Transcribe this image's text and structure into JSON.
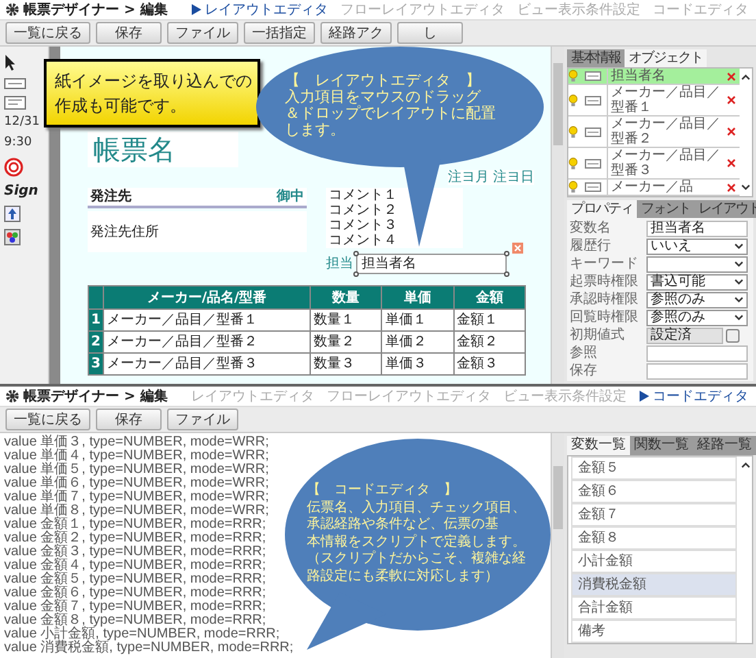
{
  "top": {
    "header": {
      "title": "帳票デザイナー > 編集",
      "tabs": [
        {
          "label": "レイアウトエディタ",
          "selected": true
        },
        {
          "label": "フローレイアウトエディタ",
          "selected": false
        },
        {
          "label": "ビュー表示条件設定",
          "selected": false
        },
        {
          "label": "コードエディタ",
          "selected": false
        }
      ]
    },
    "toolbar": [
      "一覧に戻る",
      "保存",
      "ファイル",
      "一括指定",
      "経路アク",
      "し"
    ],
    "palette": {
      "date": "12/31",
      "time": "9:30",
      "sign": "Sign"
    },
    "note": [
      "紙イメージを取り込んでの",
      "作成も可能です。"
    ],
    "callout": [
      "【　レイアウトエディタ　】",
      "入力項目をマウスのドラッグ",
      "＆ドロップでレイアウトに配置",
      "します。"
    ],
    "form": {
      "title": "帳票名",
      "date": "注ヨ月 注ヨ日",
      "recipient": "発注先",
      "honorific": "御中",
      "address": "発注先住所",
      "comments": [
        "コメント１",
        "コメント２",
        "コメント３",
        "コメント４"
      ],
      "staff_label": "担当",
      "staff_field": "担当者名",
      "table": {
        "columns": [
          "メーカー/品名/型番",
          "数量",
          "単価",
          "金額"
        ],
        "rows": [
          {
            "no": "1",
            "cells": [
              "メーカー／品目／型番１",
              "数量１",
              "単価１",
              "金額１"
            ]
          },
          {
            "no": "2",
            "cells": [
              "メーカー／品目／型番２",
              "数量２",
              "単価２",
              "金額２"
            ]
          },
          {
            "no": "3",
            "cells": [
              "メーカー／品目／型番３",
              "数量３",
              "単価３",
              "金額３"
            ]
          }
        ]
      }
    },
    "side": {
      "tabs": [
        {
          "label": "基本情報",
          "selected": false
        },
        {
          "label": "オブジェクト",
          "selected": true
        }
      ],
      "objects": [
        {
          "name": "担当者名",
          "selected": true
        },
        {
          "name": "メーカー／品目／型番１",
          "selected": false
        },
        {
          "name": "メーカー／品目／型番２",
          "selected": false
        },
        {
          "name": "メーカー／品目／型番３",
          "selected": false
        },
        {
          "name": "メーカー／品",
          "selected": false
        }
      ],
      "prop_tabs": [
        {
          "label": "プロパティ",
          "selected": true
        },
        {
          "label": "フォント",
          "selected": false
        },
        {
          "label": "レイアウト",
          "selected": false
        }
      ],
      "props": [
        {
          "label": "変数名",
          "kind": "text",
          "value": "担当者名"
        },
        {
          "label": "履歴行",
          "kind": "select",
          "value": "いいえ"
        },
        {
          "label": "キーワード",
          "kind": "select"
        },
        {
          "label": "起票時権限",
          "kind": "select",
          "value": "書込可能"
        },
        {
          "label": "承認時権限",
          "kind": "select",
          "value": "参照のみ"
        },
        {
          "label": "回覧時権限",
          "kind": "select",
          "value": "参照のみ"
        },
        {
          "label": "初期値式",
          "kind": "readonly",
          "value": "設定済"
        },
        {
          "label": "参照",
          "kind": "text"
        },
        {
          "label": "保存",
          "kind": "text"
        }
      ]
    }
  },
  "bottom": {
    "header": {
      "title": "帳票デザイナー > 編集",
      "tabs": [
        {
          "label": "レイアウトエディタ",
          "selected": false
        },
        {
          "label": "フローレイアウトエディタ",
          "selected": false
        },
        {
          "label": "ビュー表示条件設定",
          "selected": false
        },
        {
          "label": "コードエディタ",
          "selected": true
        }
      ]
    },
    "toolbar": [
      "一覧に戻る",
      "保存",
      "ファイル"
    ],
    "code": [
      "value 単価３, type=NUMBER, mode=WRR;",
      "value 単価４, type=NUMBER, mode=WRR;",
      "value 単価５, type=NUMBER, mode=WRR;",
      "value 単価６, type=NUMBER, mode=WRR;",
      "value 単価７, type=NUMBER, mode=WRR;",
      "value 単価８, type=NUMBER, mode=WRR;",
      "value 金額１, type=NUMBER, mode=RRR;",
      "value 金額２, type=NUMBER, mode=RRR;",
      "value 金額３, type=NUMBER, mode=RRR;",
      "value 金額４, type=NUMBER, mode=RRR;",
      "value 金額５, type=NUMBER, mode=RRR;",
      "value 金額６, type=NUMBER, mode=RRR;",
      "value 金額７, type=NUMBER, mode=RRR;",
      "value 金額８, type=NUMBER, mode=RRR;",
      "value 小計金額, type=NUMBER, mode=RRR;",
      "value 消費税金額, type=NUMBER, mode=RRR;"
    ],
    "callout": [
      "【　コードエディタ　】",
      "伝票名、入力項目、チェック項目、",
      "承認経路や条件など、伝票の基",
      "本情報をスクリプトで定義します。",
      "（スクリプトだからこそ、複雑な経",
      "路設定にも柔軟に対応します）"
    ],
    "side": {
      "tabs": [
        {
          "label": "変数一覧",
          "selected": true
        },
        {
          "label": "関数一覧",
          "selected": false
        },
        {
          "label": "経路一覧",
          "selected": false
        }
      ],
      "vars": [
        {
          "name": "金額５",
          "selected": false
        },
        {
          "name": "金額６",
          "selected": false
        },
        {
          "name": "金額７",
          "selected": false
        },
        {
          "name": "金額８",
          "selected": false
        },
        {
          "name": "小計金額",
          "selected": false
        },
        {
          "name": "消費税金額",
          "selected": true
        },
        {
          "name": "合計金額",
          "selected": false
        },
        {
          "name": "備考",
          "selected": false
        }
      ]
    }
  }
}
